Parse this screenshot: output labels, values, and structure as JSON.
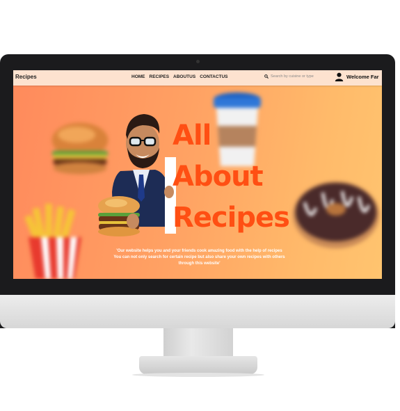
{
  "navbar": {
    "brand": "Recipes",
    "links": [
      "HOME",
      "RECIPES",
      "ABOUTUS",
      "CONTACTUS"
    ],
    "search_placeholder": "Search by cuisine or type",
    "welcome": "Welcome Far"
  },
  "hero": {
    "title_lines": [
      "All",
      "About",
      "Recipes"
    ],
    "tagline_lines": [
      "'Our website helps you and your friends cook amazing food with the help of recipes",
      "You can not only search for certain recipe but also share your own recipes with others",
      "through this website'"
    ]
  },
  "colors": {
    "title": "#ff4f13",
    "navbar_bg": "#fde2cf",
    "screen_gradient_start": "#ff8a5c",
    "screen_gradient_end": "#ffc46f"
  },
  "icons": [
    "search-icon",
    "user-icon"
  ]
}
